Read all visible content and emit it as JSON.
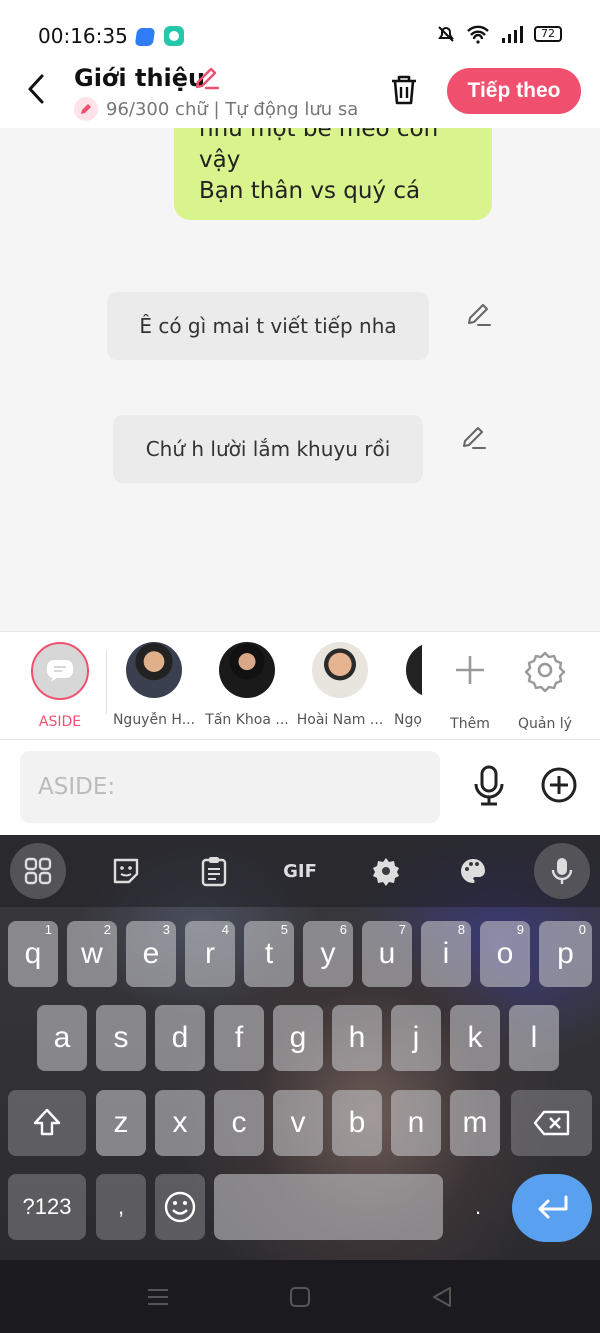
{
  "status_bar": {
    "time": "00:16:35",
    "battery": "72"
  },
  "header": {
    "title": "Giới thiệu",
    "subtitle": "96/300 chữ | Tự động lưu sa",
    "next_label": "Tiếp theo"
  },
  "chat": {
    "green_bubble_lines": [
      "như một bé mèo con",
      "vậy",
      "Bạn thân vs quý cá"
    ],
    "grey_bubbles": [
      "Ê có gì mai t viết tiếp nha",
      "Chứ h lười lắm khuyu rồi"
    ]
  },
  "personas": [
    {
      "label": "ASIDE"
    },
    {
      "label": "Nguyễn H..."
    },
    {
      "label": "Tấn Khoa ..."
    },
    {
      "label": "Hoài Nam ..."
    },
    {
      "label": "Ngọ"
    }
  ],
  "persona_actions": {
    "add_label": "Thêm",
    "manage_label": "Quản lý"
  },
  "input": {
    "placeholder": "ASIDE:"
  },
  "keyboard": {
    "gif_label": "GIF",
    "row1": [
      [
        "q",
        "1"
      ],
      [
        "w",
        "2"
      ],
      [
        "e",
        "3"
      ],
      [
        "r",
        "4"
      ],
      [
        "t",
        "5"
      ],
      [
        "y",
        "6"
      ],
      [
        "u",
        "7"
      ],
      [
        "i",
        "8"
      ],
      [
        "o",
        "9"
      ],
      [
        "p",
        "0"
      ]
    ],
    "row2": [
      "a",
      "s",
      "d",
      "f",
      "g",
      "h",
      "j",
      "k",
      "l"
    ],
    "row3": [
      "z",
      "x",
      "c",
      "v",
      "b",
      "n",
      "m"
    ],
    "symbols_label": "?123",
    "comma": ",",
    "period": "."
  },
  "colors": {
    "accent": "#f0506e",
    "green_bubble": "#d9f48c",
    "enter": "#5aa0f0"
  }
}
